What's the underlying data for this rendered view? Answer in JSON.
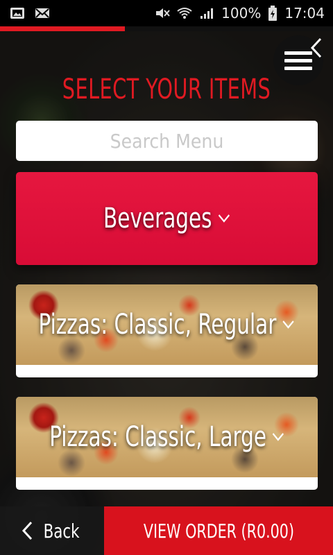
{
  "status_bar": {
    "battery": "100%",
    "time": "17:04"
  },
  "progress": 0.375,
  "header": {
    "title": "SELECT YOUR ITEMS"
  },
  "search": {
    "placeholder": "Search Menu"
  },
  "categories": [
    {
      "label": "Beverages"
    },
    {
      "label": "Pizzas: Classic, Regular"
    },
    {
      "label": "Pizzas: Classic, Large"
    }
  ],
  "footer": {
    "back_label": "Back",
    "view_order_label": "VIEW ORDER (R0.00)"
  },
  "colors": {
    "accent": "#e01a22",
    "beverages_bg": "#dc1038",
    "view_order_bg": "#d8121d"
  },
  "icons": [
    "image-icon",
    "mail-icon",
    "mute-icon",
    "wifi-icon",
    "signal-icon",
    "battery-icon",
    "menu-icon",
    "chevron-left-icon",
    "chevron-down-icon",
    "back-chevron-icon"
  ]
}
